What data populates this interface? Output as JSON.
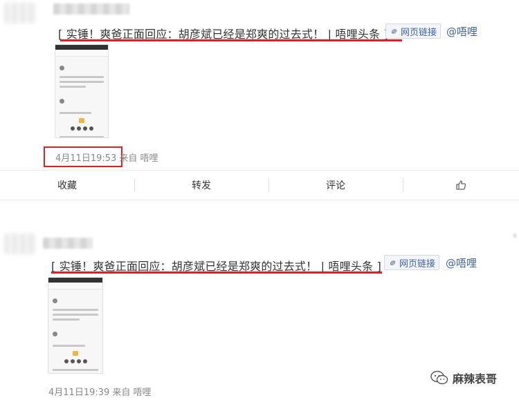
{
  "posts": [
    {
      "headline": "[ 实锤！爽爸正面回应：胡彦斌已经是郑爽的过去式！ | 唔哩头条 ]",
      "link_label": "网页链接",
      "mention": "@唔哩",
      "timestamp": "4月11日19:53",
      "source": "来自 唔哩"
    },
    {
      "headline": "[ 实锤！爽爸正面回应：胡彦斌已经是郑爽的过去式！ | 唔哩头条 ]",
      "link_label": "网页链接",
      "mention": "@唔哩",
      "timestamp": "4月11日19:39",
      "source": "来自 唔哩"
    }
  ],
  "actions": {
    "favorite": "收藏",
    "repost": "转发",
    "comment": "评论"
  },
  "watermark": {
    "text": "麻辣表哥"
  },
  "colors": {
    "link_blue": "#3f63a6",
    "highlight_red": "#e02020",
    "text_gray": "#888888"
  },
  "icons": [
    "link-icon",
    "thumbs-up-icon",
    "wechat-icon"
  ]
}
